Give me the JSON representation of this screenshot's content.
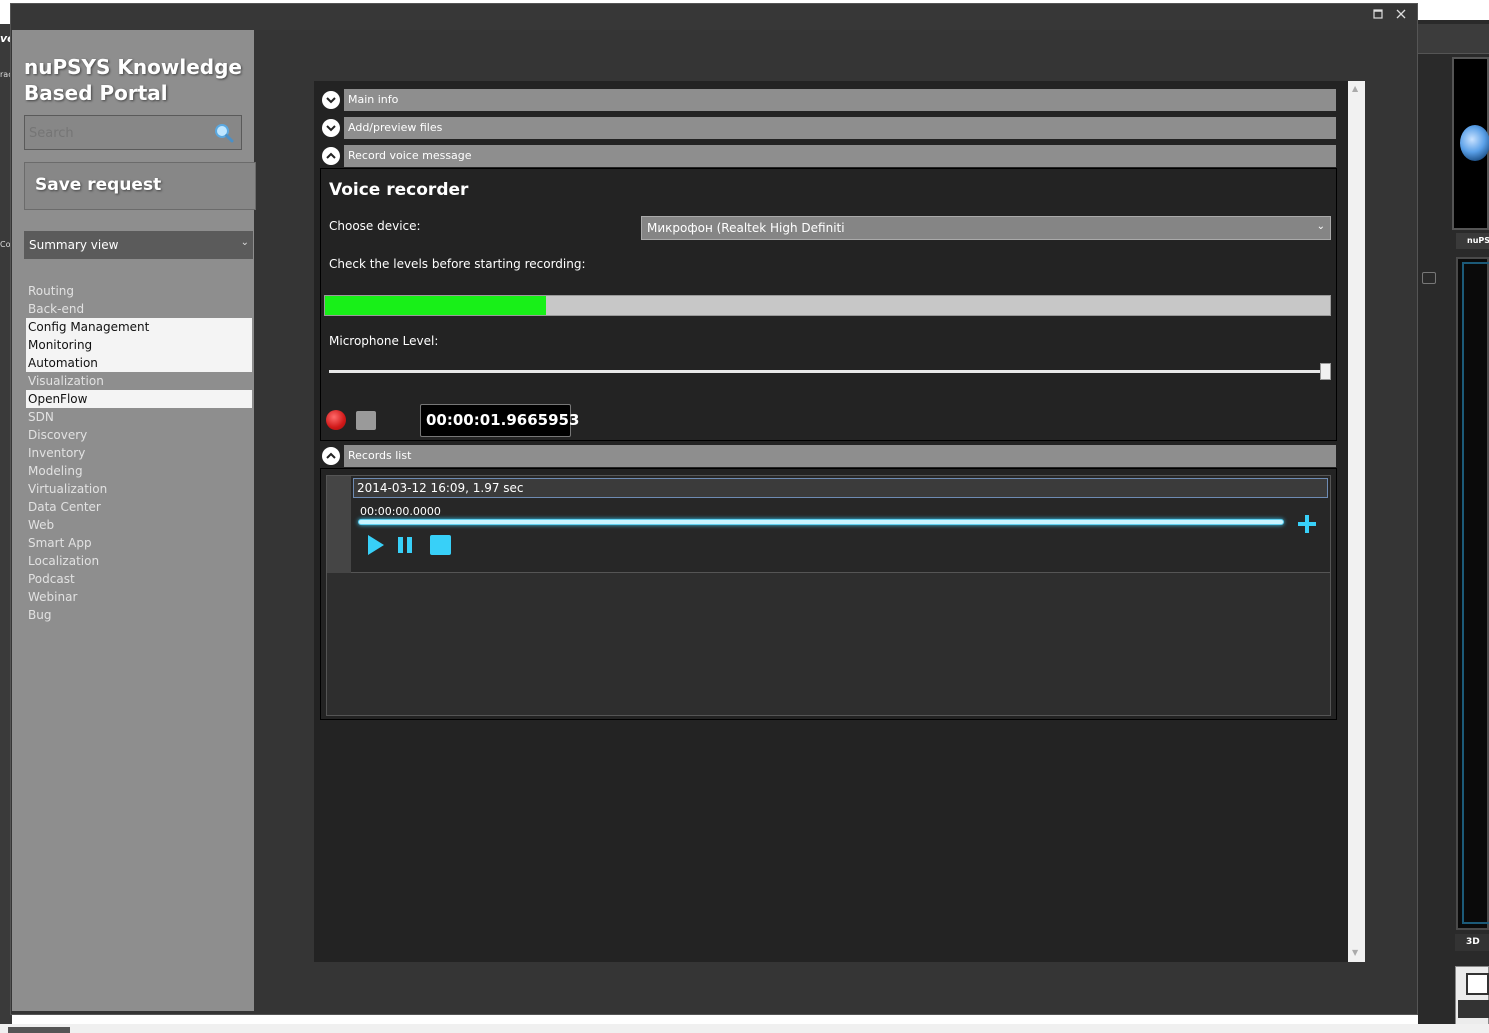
{
  "window": {
    "maximize_icon": "square-icon",
    "close_icon": "close-icon"
  },
  "sidebar": {
    "title": "nuPSYS Knowledge Based Portal",
    "search_placeholder": "Search",
    "save_label": "Save request",
    "view_select": "Summary view",
    "nav_items": [
      {
        "label": "Routing",
        "selected": false
      },
      {
        "label": "Back-end",
        "selected": false
      },
      {
        "label": "Config Management",
        "selected": true
      },
      {
        "label": "Monitoring",
        "selected": true
      },
      {
        "label": "Automation",
        "selected": true
      },
      {
        "label": "Visualization",
        "selected": false
      },
      {
        "label": "OpenFlow",
        "selected": true
      },
      {
        "label": "SDN",
        "selected": false
      },
      {
        "label": "Discovery",
        "selected": false
      },
      {
        "label": "Inventory",
        "selected": false
      },
      {
        "label": "Modeling",
        "selected": false
      },
      {
        "label": "Virtualization",
        "selected": false
      },
      {
        "label": "Data Center",
        "selected": false
      },
      {
        "label": "Web",
        "selected": false
      },
      {
        "label": "Smart App",
        "selected": false
      },
      {
        "label": "Localization",
        "selected": false
      },
      {
        "label": "Podcast",
        "selected": false
      },
      {
        "label": "Webinar",
        "selected": false
      },
      {
        "label": "Bug",
        "selected": false
      }
    ]
  },
  "sections": {
    "main_info": "Main info",
    "add_preview_files": "Add/preview files",
    "record_voice": "Record voice message",
    "records_list": "Records list"
  },
  "recorder": {
    "title": "Voice recorder",
    "choose_device_label": "Choose device:",
    "device_value": "Микрофон (Realtek High Definiti",
    "check_levels_label": "Check the levels before starting recording:",
    "input_level": 0.22,
    "mic_level_label": "Microphone Level:",
    "mic_level_value": 1.0,
    "timer": "00:00:01.9665953"
  },
  "records": [
    {
      "title": "2014-03-12 16:09, 1.97 sec",
      "position": "00:00:00.0000"
    }
  ],
  "colors": {
    "level_fill": "#18f018",
    "player_accent": "#38d0f8",
    "record_red": "#d01818"
  },
  "background_app": {
    "tab_label": "nuPS",
    "view_3d_label": "3D",
    "left_text_1": "ve",
    "left_text_2": "rac",
    "left_text_3": "Cor"
  }
}
